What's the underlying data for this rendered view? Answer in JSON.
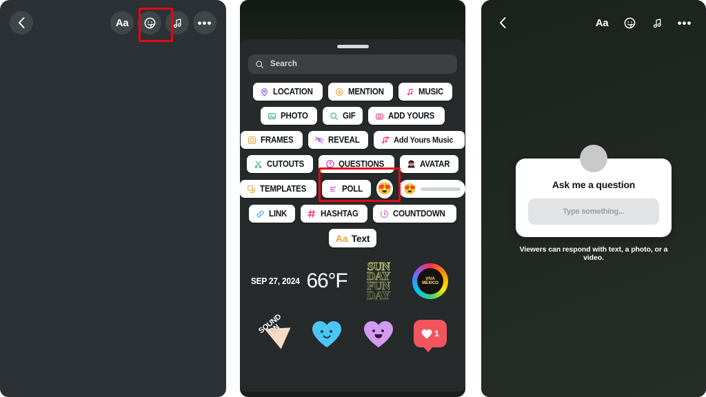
{
  "panels": {
    "left": {
      "name": "story-editor-initial",
      "toolbar": {
        "back_icon": "chevron-left-icon",
        "text_tool_label": "Aa",
        "sticker_icon": "sticker-smiley-icon",
        "music_icon": "music-note-icon",
        "more_icon": "ellipsis-icon"
      },
      "highlight": {
        "target": "sticker-tray-button",
        "color": "#e50914"
      }
    },
    "middle": {
      "name": "sticker-tray-sheet",
      "search": {
        "placeholder": "Search",
        "icon": "search-icon"
      },
      "grabber": "drag-handle",
      "highlight": {
        "target": "questions-sticker",
        "color": "#e50914"
      },
      "sticker_rows": [
        [
          {
            "label": "LOCATION",
            "icon": "location-pin-icon",
            "color": "#7b4ddb"
          },
          {
            "label": "MENTION",
            "icon": "at-threads-icon",
            "color": "#e8a33d"
          },
          {
            "label": "MUSIC",
            "icon": "music-note-icon",
            "color": "#ef2b7a"
          }
        ],
        [
          {
            "label": "PHOTO",
            "icon": "photo-image-icon",
            "color": "#2bb673"
          },
          {
            "label": "GIF",
            "icon": "gif-search-icon",
            "color": "#2bb673"
          },
          {
            "label": "ADD YOURS",
            "icon": "camera-icon",
            "color": "#ef2b7a"
          }
        ],
        [
          {
            "label": "FRAMES",
            "icon": "frame-square-icon",
            "color": "#e8a33d"
          },
          {
            "label": "REVEAL",
            "icon": "eye-slash-icon",
            "color": "#b24dd6"
          },
          {
            "label": "Add Yours Music",
            "icon": "music-plus-icon",
            "color": "#ef2b7a",
            "mixed_case": true
          }
        ],
        [
          {
            "label": "CUTOUTS",
            "icon": "scissors-icon",
            "color": "#2bb673"
          },
          {
            "label": "QUESTIONS",
            "icon": "question-chat-icon",
            "color": "#c33ad0"
          },
          {
            "label": "AVATAR",
            "icon": "avatar-face-icon",
            "color": "#ef2b7a"
          }
        ],
        [
          {
            "label": "TEMPLATES",
            "icon": "templates-stack-icon",
            "color": "#e8a33d"
          },
          {
            "label": "POLL",
            "icon": "poll-bars-icon",
            "color": "#b24dd6"
          }
        ],
        [
          {
            "label": "LINK",
            "icon": "link-chain-icon",
            "color": "#2f9fe0"
          },
          {
            "label": "HASHTAG",
            "icon": "hashtag-icon",
            "color": "#ef2b7a"
          },
          {
            "label": "COUNTDOWN",
            "icon": "countdown-timer-icon",
            "color": "#c33ad0"
          }
        ]
      ],
      "emoji_slider": {
        "emoji": "😍",
        "emoji_name": "heart-eyes-emoji"
      },
      "emoji_reaction": {
        "emoji": "😍",
        "emoji_name": "heart-eyes-emoji"
      },
      "text_sticker": {
        "aa": "Aa",
        "label": "Text"
      },
      "gallery": {
        "date_sticker": "SEP 27, 2024",
        "temperature_sticker": "66°F",
        "sunday_funday": [
          "SUN",
          "DAY",
          "FUN",
          "DAY"
        ],
        "viva_sticker": "VIVA MEXICO",
        "sound_on": [
          "SOUND",
          "ON"
        ],
        "heart_blue": "smiling-heart-blue",
        "heart_purple": "smiling-heart-purple",
        "like_count": "1",
        "like_icon": "heart-icon"
      }
    },
    "right": {
      "name": "story-editor-with-question-sticker",
      "toolbar": {
        "back_icon": "chevron-left-icon",
        "text_tool_label": "Aa",
        "sticker_icon": "sticker-smiley-icon",
        "music_icon": "music-note-icon",
        "more_icon": "ellipsis-icon"
      },
      "question_card": {
        "avatar": "profile-avatar",
        "title": "Ask me a question",
        "input_placeholder": "Type something...",
        "caption": "Viewers can respond with text, a photo, or a video."
      }
    }
  }
}
